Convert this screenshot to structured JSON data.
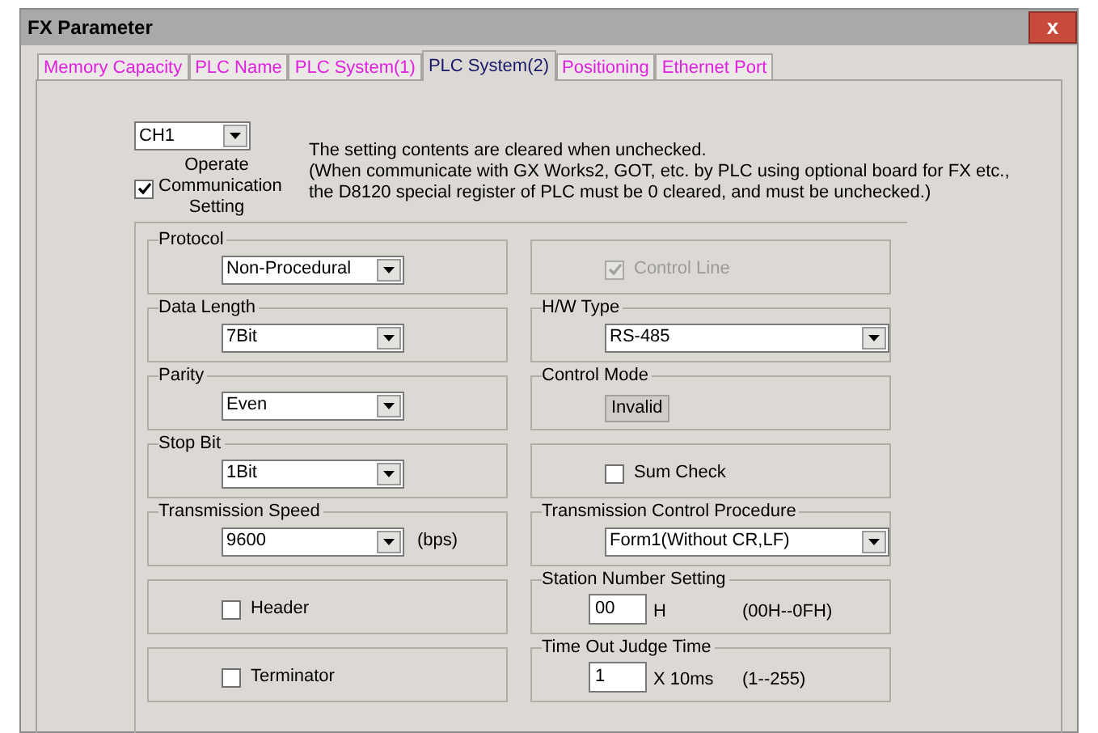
{
  "window": {
    "title": "FX Parameter",
    "close": "x"
  },
  "tabs": [
    {
      "label": "Memory Capacity",
      "selected": false
    },
    {
      "label": "PLC Name",
      "selected": false
    },
    {
      "label": "PLC System(1)",
      "selected": false
    },
    {
      "label": "PLC System(2)",
      "selected": true
    },
    {
      "label": "Positioning",
      "selected": false
    },
    {
      "label": "Ethernet Port",
      "selected": false
    }
  ],
  "channel": {
    "value": "CH1"
  },
  "operate": {
    "label": "Operate Communication Setting",
    "checked": true
  },
  "note": [
    "The setting contents are cleared when unchecked.",
    "(When communicate with GX Works2, GOT, etc. by PLC using optional board for FX etc.,",
    "the D8120 special register of PLC must be 0 cleared, and must be unchecked.)"
  ],
  "left_groups": [
    {
      "kind": "select",
      "title": "Protocol",
      "value": "Non-Procedural"
    },
    {
      "kind": "select",
      "title": "Data Length",
      "value": "7Bit"
    },
    {
      "kind": "select",
      "title": "Parity",
      "value": "Even"
    },
    {
      "kind": "select",
      "title": "Stop Bit",
      "value": "1Bit"
    },
    {
      "kind": "select",
      "title": "Transmission Speed",
      "value": "9600",
      "unit": "(bps)"
    },
    {
      "kind": "checkbox",
      "label": "Header",
      "checked": false,
      "disabled": false
    },
    {
      "kind": "checkbox",
      "label": "Terminator",
      "checked": false,
      "disabled": false
    }
  ],
  "right_groups": [
    {
      "kind": "checkbox",
      "label": "Control Line",
      "checked": true,
      "disabled": true
    },
    {
      "kind": "select",
      "title": "H/W Type",
      "value": "RS-485"
    },
    {
      "kind": "readonly",
      "title": "Control Mode",
      "value": "Invalid"
    },
    {
      "kind": "checkbox",
      "label": "Sum Check",
      "checked": false,
      "disabled": false
    },
    {
      "kind": "select",
      "title": "Transmission Control Procedure",
      "value": "Form1(Without CR,LF)"
    },
    {
      "kind": "input",
      "title": "Station Number Setting",
      "value": "00",
      "unit": "H",
      "range": "(00H--0FH)"
    },
    {
      "kind": "input",
      "title": "Time Out Judge Time",
      "value": "1",
      "unit": "X 10ms",
      "range": "(1--255)"
    }
  ]
}
